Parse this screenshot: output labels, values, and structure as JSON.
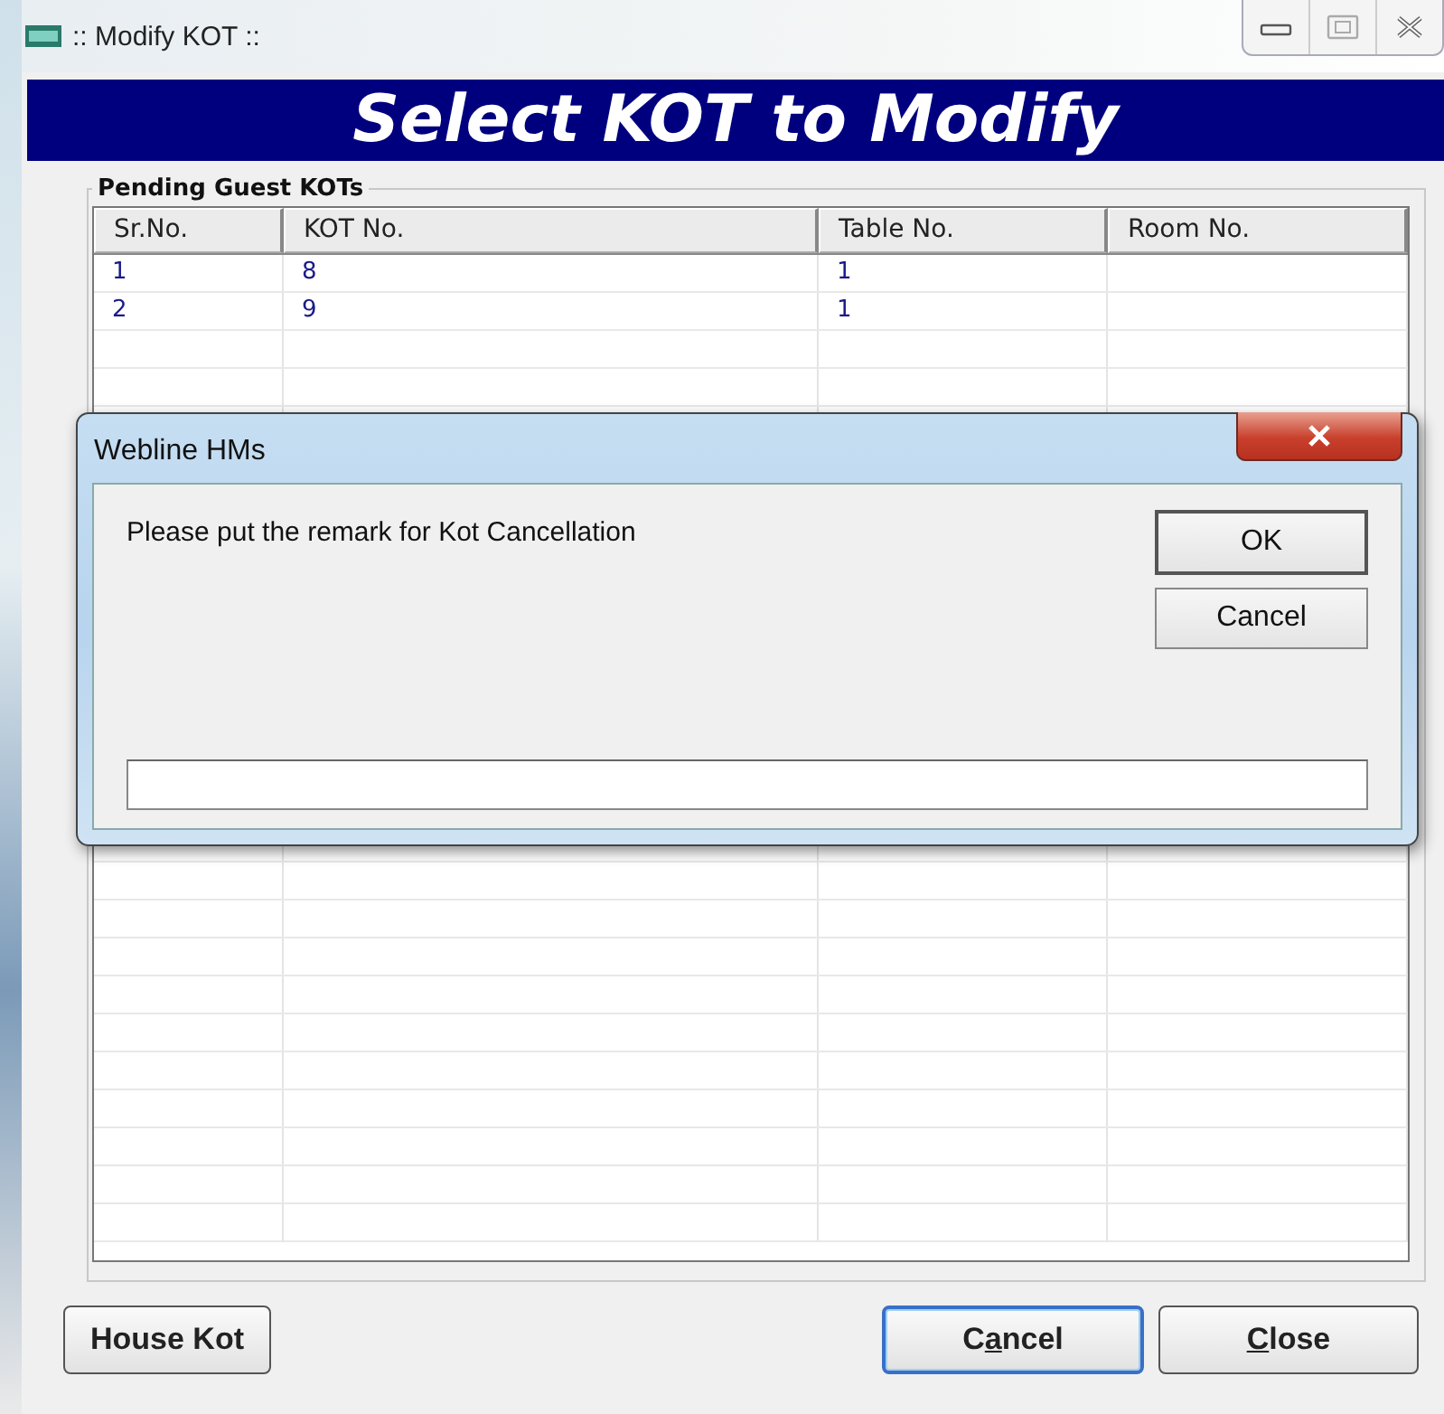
{
  "window": {
    "title": ":: Modify KOT ::"
  },
  "header": {
    "title": "Select KOT to Modify"
  },
  "group": {
    "title": "Pending Guest KOTs"
  },
  "table": {
    "columns": [
      "Sr.No.",
      "KOT No.",
      "Table No.",
      "Room No."
    ],
    "rows": [
      {
        "cells": [
          "1",
          "8",
          "1",
          ""
        ]
      },
      {
        "cells": [
          "2",
          "9",
          "1",
          ""
        ]
      }
    ]
  },
  "footer": {
    "left_buttons": [
      {
        "label": {
          "text": "House Kot"
        },
        "default": false
      }
    ],
    "right_buttons": [
      {
        "label": {
          "text": "C",
          "access_key": "a",
          "rest": "ncel"
        },
        "default": true
      },
      {
        "label": {
          "access_key": "C",
          "rest": "lose"
        },
        "default": false
      }
    ]
  },
  "dialog": {
    "title": "Webline HMs",
    "message": "Please put the remark for Kot Cancellation",
    "buttons": [
      {
        "label": "OK",
        "default": true
      },
      {
        "label": "Cancel",
        "default": false
      }
    ]
  }
}
